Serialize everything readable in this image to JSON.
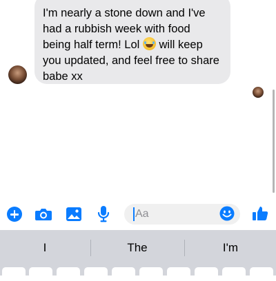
{
  "message": {
    "line1": "I'm nearly a stone down and I've",
    "line2": "had a rubbish week with food",
    "line3_before_emoji": "being half term! Lol ",
    "line3_after_emoji": " will keep",
    "line4": "you updated, and feel free to share",
    "line5": "babe xx",
    "emoji": "laughing-with-tears-emoji"
  },
  "composer": {
    "input_placeholder": "Aa",
    "accent_color": "#0a7cff",
    "icons": [
      "plus-icon",
      "camera-icon",
      "photo-icon",
      "microphone-icon",
      "emoji-icon",
      "thumbs-up-icon"
    ]
  },
  "keyboard": {
    "suggestions": [
      "I",
      "The",
      "I'm"
    ]
  }
}
